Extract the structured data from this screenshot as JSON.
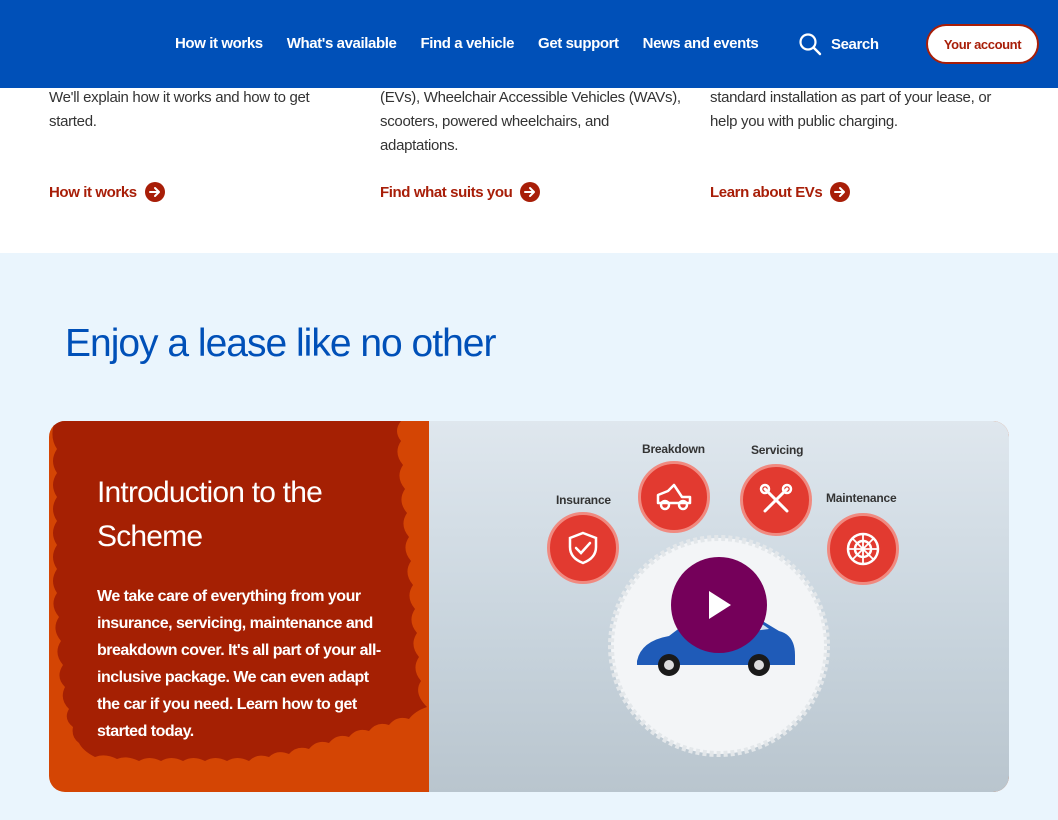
{
  "nav": {
    "items": [
      "How it works",
      "What's available",
      "Find a vehicle",
      "Get support",
      "News and events"
    ],
    "search_label": "Search",
    "account_label": "Your account"
  },
  "columns": [
    {
      "text": "We'll explain how it works and how to get started.",
      "link": "How it works"
    },
    {
      "text": "(EVs), Wheelchair Accessible Vehicles (WAVs), scooters, powered wheelchairs, and adaptations.",
      "link": "Find what suits you"
    },
    {
      "text": "standard installation as part of your lease, or help you with public charging.",
      "link": "Learn about EVs"
    }
  ],
  "section_heading": "Enjoy a lease like no other",
  "card": {
    "title": "Introduction to the Scheme",
    "body": "We take care of everything from your insurance, servicing, maintenance and breakdown cover. It's all part of your all-inclusive package. We can even adapt the car if you need. Learn how to get started today.",
    "video": {
      "labels": [
        "Insurance",
        "Breakdown",
        "Servicing",
        "Maintenance"
      ]
    }
  },
  "colors": {
    "header_bg": "#0050b8",
    "accent_red": "#a81e08",
    "card_orange": "#d44504",
    "play_purple": "#75005a"
  }
}
